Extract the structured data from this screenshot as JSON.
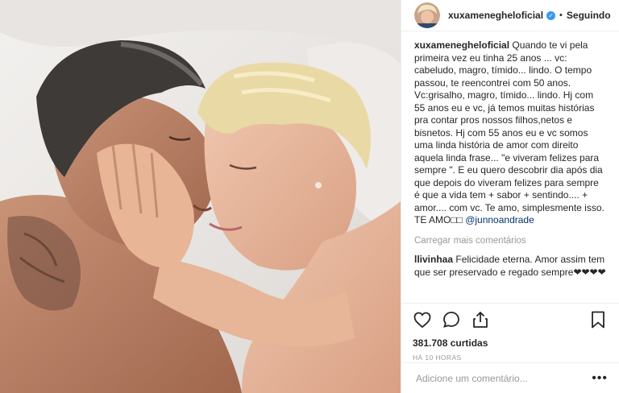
{
  "header": {
    "username": "xuxamenegheloficial",
    "separator": "•",
    "follow_label": "Seguindo"
  },
  "caption": {
    "username": "xuxamenegheloficial",
    "text": "Quando te vi pela primeira vez eu tinha 25 anos ... vc: cabeludo, magro, tímido... lindo. O tempo passou, te reencontrei com 50 anos. Vc:grisalho, magro, tímido... lindo. Hj com 55 anos eu e vc, já temos muitas histórias pra contar pros nossos filhos,netos e bisnetos. Hj com 55 anos eu e vc somos uma linda história de amor com direito aquela linda frase... \"e viveram felizes para sempre \". E eu quero descobrir dia após dia que depois do viveram felizes para sempre é que a vida tem + sabor + sentindo.... + amor.... com vc. Te amo, simplesmente isso. TE AMO□□",
    "mention": "@junnoandrade"
  },
  "load_more": "Carregar mais comentários",
  "comment": {
    "username": "llivinhaa",
    "text": "Felicidade eterna. Amor assim tem que ser preservado e regado sempre❤❤❤❤"
  },
  "likes": "381.708 curtidas",
  "time": "HÁ 10 HORAS",
  "add_comment": {
    "placeholder": "Adicione um comentário..."
  },
  "more_label": "•••"
}
